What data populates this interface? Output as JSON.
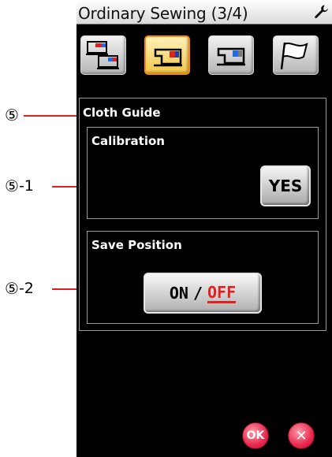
{
  "callouts": [
    {
      "num": "⑤",
      "suffix": ""
    },
    {
      "num": "⑤",
      "suffix": "-1"
    },
    {
      "num": "⑤",
      "suffix": "-2"
    }
  ],
  "header": {
    "title": "Ordinary Sewing (3/4)",
    "settings_icon": "wrench-icon"
  },
  "tabs": [
    {
      "icon": "two-machines-icon",
      "active": false
    },
    {
      "icon": "machine-red-icon",
      "active": true
    },
    {
      "icon": "machine-blue-icon",
      "active": false
    },
    {
      "icon": "flag-icon",
      "active": false
    }
  ],
  "cloth_guide": {
    "title": "Cloth Guide",
    "calibration": {
      "label": "Calibration",
      "button": "YES"
    },
    "save_position": {
      "label": "Save Position",
      "on_label": "ON",
      "separator": "/",
      "off_label": "OFF",
      "selected": "OFF"
    }
  },
  "footer": {
    "ok_label": "OK",
    "close_label": "✕"
  },
  "colors": {
    "accent_red": "#e51e1e",
    "active_tab": "#f1c64c",
    "active_tab_border": "#ff8a00",
    "screen_bg": "#000000"
  }
}
